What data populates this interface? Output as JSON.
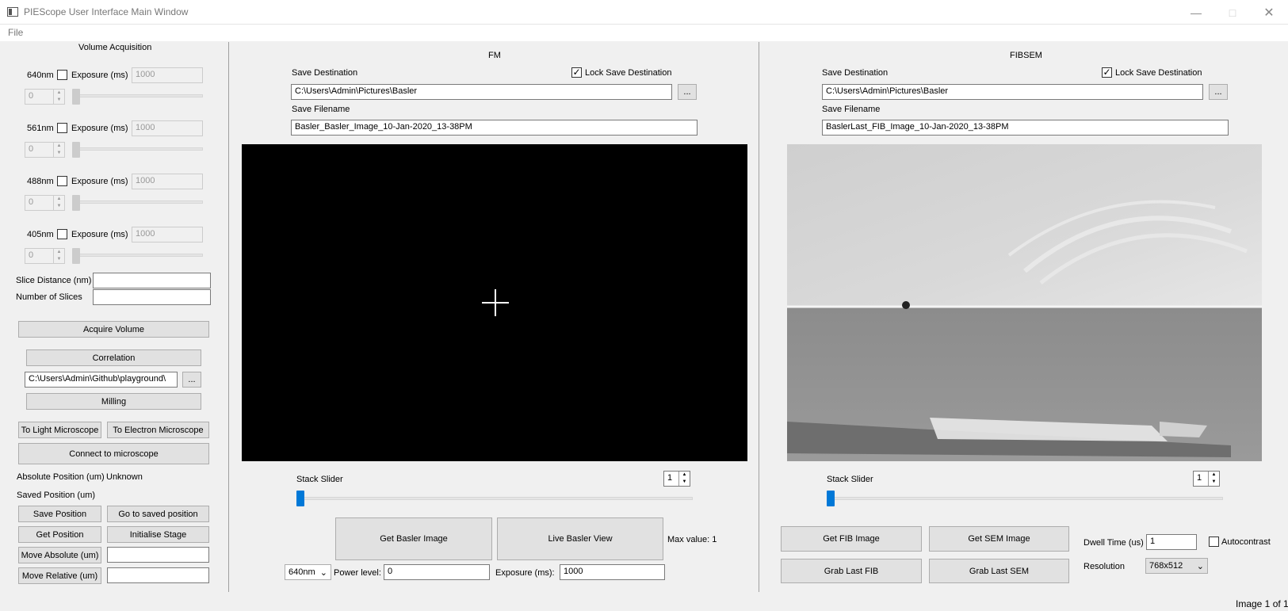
{
  "window": {
    "title": "PIEScope User Interface Main Window",
    "icon": "app-window-icon",
    "minimize_icon": "minimize-icon",
    "maximize_icon": "maximize-icon",
    "close_icon": "close-icon"
  },
  "menu": {
    "file": "File"
  },
  "volume": {
    "title": "Volume Acquisition",
    "lasers": [
      {
        "name": "640nm",
        "checked": false,
        "exposure_label": "Exposure (ms)",
        "exposure": "1000",
        "spin": "0"
      },
      {
        "name": "561nm",
        "checked": false,
        "exposure_label": "Exposure (ms)",
        "exposure": "1000",
        "spin": "0"
      },
      {
        "name": "488nm",
        "checked": false,
        "exposure_label": "Exposure (ms)",
        "exposure": "1000",
        "spin": "0"
      },
      {
        "name": "405nm",
        "checked": false,
        "exposure_label": "Exposure (ms)",
        "exposure": "1000",
        "spin": "0"
      }
    ],
    "slice_distance_label": "Slice Distance (nm)",
    "slice_distance": "",
    "num_slices_label": "Number of Slices",
    "num_slices": "",
    "acquire_button": "Acquire Volume",
    "correlation_button": "Correlation",
    "correlation_path": "C:\\Users\\Admin\\Github\\playground\\",
    "browse_button": "...",
    "milling_button": "Milling"
  },
  "movement": {
    "to_light_button": "To Light Microscope",
    "to_electron_button": "To Electron Microscope",
    "connect_button": "Connect to microscope",
    "abs_position_label": "Absolute Position (um)",
    "abs_position_value": "Unknown",
    "saved_position_label": "Saved Position (um)",
    "save_position_button": "Save Position",
    "goto_saved_button": "Go to saved position",
    "get_position_button": "Get Position",
    "init_stage_button": "Initialise Stage",
    "move_absolute_button": "Move Absolute (um)",
    "move_absolute_value": "",
    "move_relative_button": "Move Relative (um)",
    "move_relative_value": ""
  },
  "fm": {
    "title": "FM",
    "save_dest_label": "Save Destination",
    "lock_label": "Lock Save Destination",
    "lock_checked": true,
    "save_dest": "C:\\Users\\Admin\\Pictures\\Basler",
    "browse_button": "...",
    "save_filename_label": "Save Filename",
    "save_filename": "Basler_Basler_Image_10-Jan-2020_13-38PM",
    "stack_label": "Stack Slider",
    "stack_value": "1",
    "get_image_button": "Get Basler Image",
    "live_view_button": "Live Basler View",
    "max_value_label": "Max value: 1",
    "laser_select": "640nm",
    "power_label": "Power level:",
    "power_value": "0",
    "exposure_label": "Exposure (ms):",
    "exposure_value": "1000"
  },
  "fibsem": {
    "title": "FIBSEM",
    "save_dest_label": "Save Destination",
    "lock_label": "Lock Save Destination",
    "lock_checked": true,
    "save_dest": "C:\\Users\\Admin\\Pictures\\Basler",
    "browse_button": "...",
    "save_filename_label": "Save Filename",
    "save_filename": "BaslerLast_FIB_Image_10-Jan-2020_13-38PM",
    "stack_label": "Stack Slider",
    "stack_value": "1",
    "get_fib_button": "Get FIB Image",
    "get_sem_button": "Get SEM Image",
    "grab_fib_button": "Grab Last FIB",
    "grab_sem_button": "Grab Last SEM",
    "dwell_label": "Dwell Time (us)",
    "dwell_value": "1",
    "autocontrast_label": "Autocontrast",
    "autocontrast_checked": false,
    "resolution_label": "Resolution",
    "resolution_value": "768x512"
  },
  "status": {
    "image_counter": "Image 1 of 1"
  }
}
